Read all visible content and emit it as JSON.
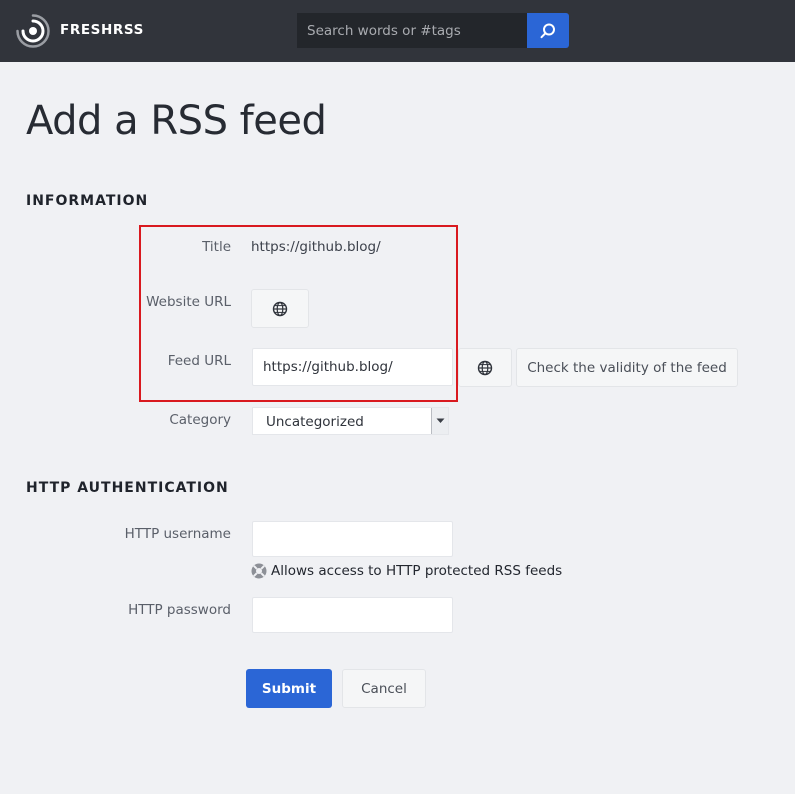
{
  "header": {
    "brand": "FRESHRSS",
    "search_placeholder": "Search words or #tags",
    "search_icon": "search-icon",
    "logo_icon": "freshrss-logo"
  },
  "page_title": "Add a RSS feed",
  "information": {
    "heading": "INFORMATION",
    "title_label": "Title",
    "title_value": "https://github.blog/",
    "website_url_label": "Website URL",
    "website_icon": "globe-icon",
    "feed_url_label": "Feed URL",
    "feed_url_value": "https://github.blog/",
    "feed_icon": "globe-icon",
    "check_button": "Check the validity of the feed",
    "category_label": "Category",
    "category_value": "Uncategorized"
  },
  "http_auth": {
    "heading": "HTTP AUTHENTICATION",
    "username_label": "HTTP username",
    "username_value": "",
    "help_icon": "help-icon",
    "help_text": "Allows access to HTTP protected RSS feeds",
    "password_label": "HTTP password",
    "password_value": ""
  },
  "actions": {
    "submit": "Submit",
    "cancel": "Cancel"
  },
  "colors": {
    "header_bg": "#31343b",
    "accent": "#2b66d6",
    "highlight": "#d9191f",
    "page_bg": "#f0f1f4"
  }
}
